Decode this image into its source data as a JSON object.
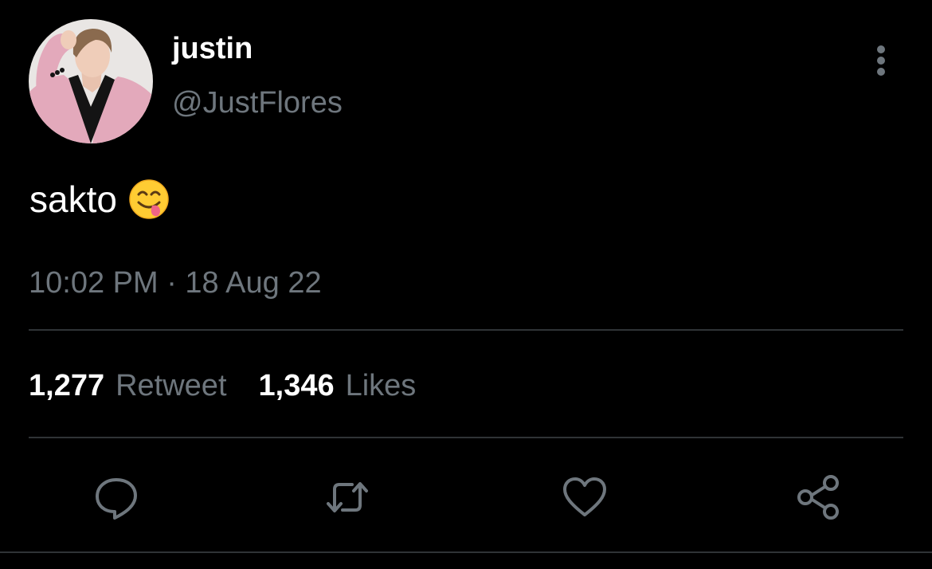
{
  "tweet": {
    "author": {
      "display_name": "justin",
      "handle": "@JustFlores",
      "avatar_icon": "profile-photo"
    },
    "text": "sakto",
    "emoji": "face-savoring-food",
    "timestamp": "10:02 PM · 18 Aug 22",
    "stats": {
      "retweets_count": "1,277",
      "retweets_label": "Retweet",
      "likes_count": "1,346",
      "likes_label": "Likes"
    },
    "actions": [
      "reply-icon",
      "retweet-icon",
      "like-icon",
      "share-icon"
    ],
    "more_icon": "more-vertical-icon"
  },
  "colors": {
    "background": "#000000",
    "primary_text": "#ffffff",
    "secondary_text": "#6e767d",
    "divider": "#2f3336"
  }
}
